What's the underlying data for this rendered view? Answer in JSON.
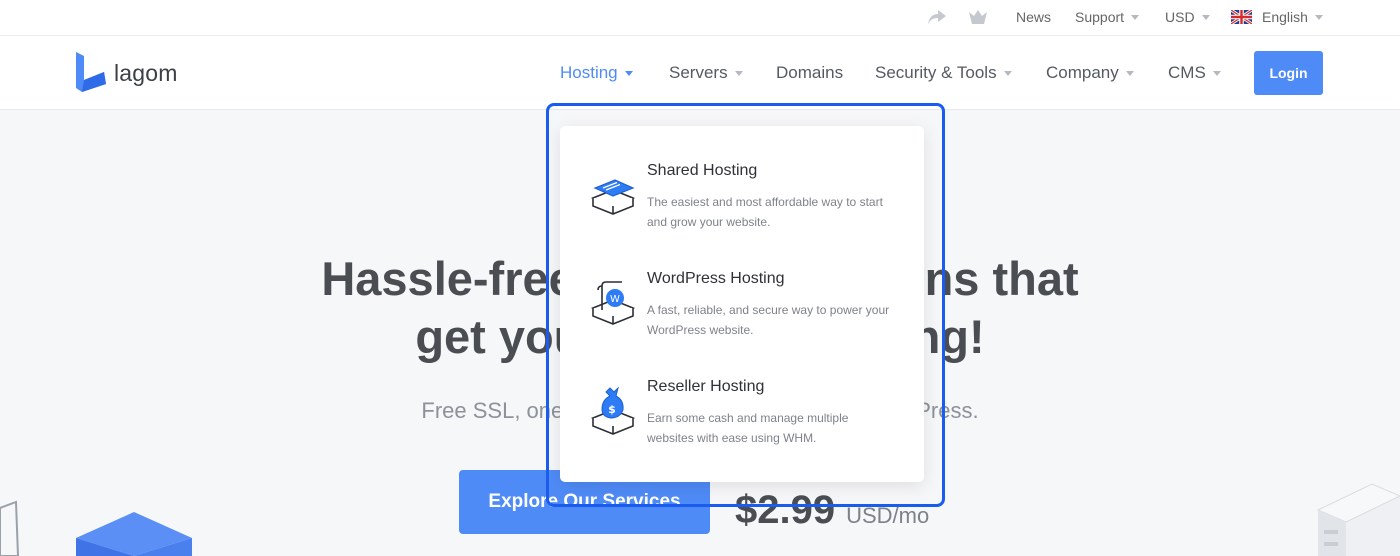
{
  "topbar": {
    "news": "News",
    "support": "Support",
    "currency": "USD",
    "language": "English"
  },
  "header": {
    "logo_text": "lagom",
    "nav": {
      "hosting": "Hosting",
      "servers": "Servers",
      "domains": "Domains",
      "security_tools": "Security & Tools",
      "company": "Company",
      "cms": "CMS"
    },
    "login_label": "Login"
  },
  "hero": {
    "title_line1": "Hassle-free hosting solutions that",
    "title_line2": "get your website soaring!",
    "subtitle": "Free SSL, one-year domain, 24/7 support for WordPress.",
    "cta_label": "Explore Our Services",
    "price_amount": "$2.99",
    "price_unit": "USD/mo"
  },
  "dropdown": {
    "items": [
      {
        "title": "Shared Hosting",
        "description": "The easiest and most affordable way to start and grow your website.",
        "icon": "shared-hosting-icon"
      },
      {
        "title": "WordPress Hosting",
        "description": "A fast, reliable, and secure way to power your WordPress website.",
        "icon": "wordpress-hosting-icon"
      },
      {
        "title": "Reseller Hosting",
        "description": "Earn some cash and manage multiple websites with ease using WHM.",
        "icon": "reseller-hosting-icon"
      }
    ]
  },
  "colors": {
    "accent": "#4f8bf7",
    "highlight": "#1a5cf0",
    "text_dark": "#4a4d52"
  }
}
